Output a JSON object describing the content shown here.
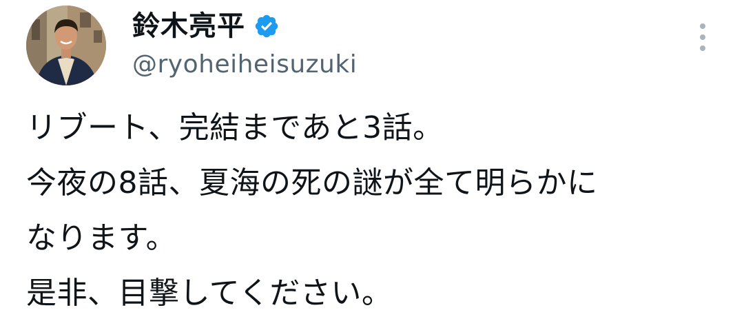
{
  "author": {
    "display_name": "鈴木亮平",
    "handle": "@ryoheiheisuzuki",
    "verified_badge_icon": "verified-check-icon",
    "verified_color": "#1d9bf0"
  },
  "menu": {
    "icon": "more-vertical-icon"
  },
  "tweet": {
    "lines": [
      "リブート、完結まであと3話。",
      "今夜の8話、夏海の死の謎が全て明らかに",
      "なります。",
      "是非、目撃してください。"
    ]
  },
  "colors": {
    "text": "#0f1419",
    "secondary": "#536471",
    "accent": "#1d9bf0"
  }
}
